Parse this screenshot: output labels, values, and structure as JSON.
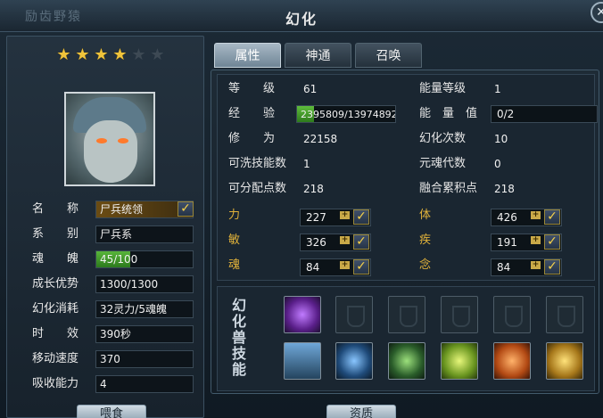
{
  "window": {
    "title": "幻化",
    "topleft_text": "励齿野猿"
  },
  "left": {
    "stars_on": 4,
    "stars_total": 6,
    "stats": [
      {
        "label": "名　　称",
        "value": "尸兵统领",
        "type": "name"
      },
      {
        "label": "系　　别",
        "value": "尸兵系"
      },
      {
        "label": "魂　　魄",
        "value": "45/100",
        "progress": 0.45
      },
      {
        "label": "成长优势",
        "value": "1300/1300"
      },
      {
        "label": "幻化消耗",
        "value": "32灵力/5魂魄"
      },
      {
        "label": "时　　效",
        "value": "390秒"
      },
      {
        "label": "移动速度",
        "value": "370"
      },
      {
        "label": "吸收能力",
        "value": "4"
      }
    ],
    "buttons": [
      "喂食",
      "资质"
    ]
  },
  "tabs": [
    {
      "label": "属性",
      "active": true
    },
    {
      "label": "神通"
    },
    {
      "label": "召唤"
    }
  ],
  "props": {
    "level_label": "等　　级",
    "level": "61",
    "energy_level_label": "能量等级",
    "energy_level": "1",
    "exp_label": "经　　验",
    "exp": "2395809/13974892",
    "exp_progress": 0.17,
    "energy_label": "能　量　值",
    "energy": "0/2",
    "cult_label": "修　　为",
    "cult": "22158",
    "hh_label": "幻化次数",
    "hh": "10",
    "wash_label": "可洗技能数",
    "wash": "1",
    "soul_gen_label": "元魂代数",
    "soul_gen": "0",
    "alloc_label": "可分配点数",
    "alloc": "218",
    "fuse_label": "融合累积点",
    "fuse": "218",
    "attrs": [
      {
        "label": "力",
        "value": "227"
      },
      {
        "label": "体",
        "value": "426"
      },
      {
        "label": "敏",
        "value": "326"
      },
      {
        "label": "疾",
        "value": "191"
      },
      {
        "label": "魂",
        "value": "84"
      },
      {
        "label": "念",
        "value": "84"
      }
    ]
  },
  "skills": {
    "title": "幻化兽技能",
    "slots": [
      {
        "icon": "purple-slash-icon"
      },
      {
        "icon": "empty-slot"
      },
      {
        "icon": "empty-slot"
      },
      {
        "icon": "empty-slot"
      },
      {
        "icon": "empty-slot"
      },
      {
        "icon": "empty-slot"
      },
      {
        "icon": "spikes-icon"
      },
      {
        "icon": "blue-shield-icon"
      },
      {
        "icon": "green-strike-icon"
      },
      {
        "icon": "green-shield-icon"
      },
      {
        "icon": "orange-shield-icon"
      },
      {
        "icon": "gold-shield-icon"
      }
    ]
  },
  "colors": {
    "accent": "#e1b23a",
    "progress": "#4aa432"
  }
}
